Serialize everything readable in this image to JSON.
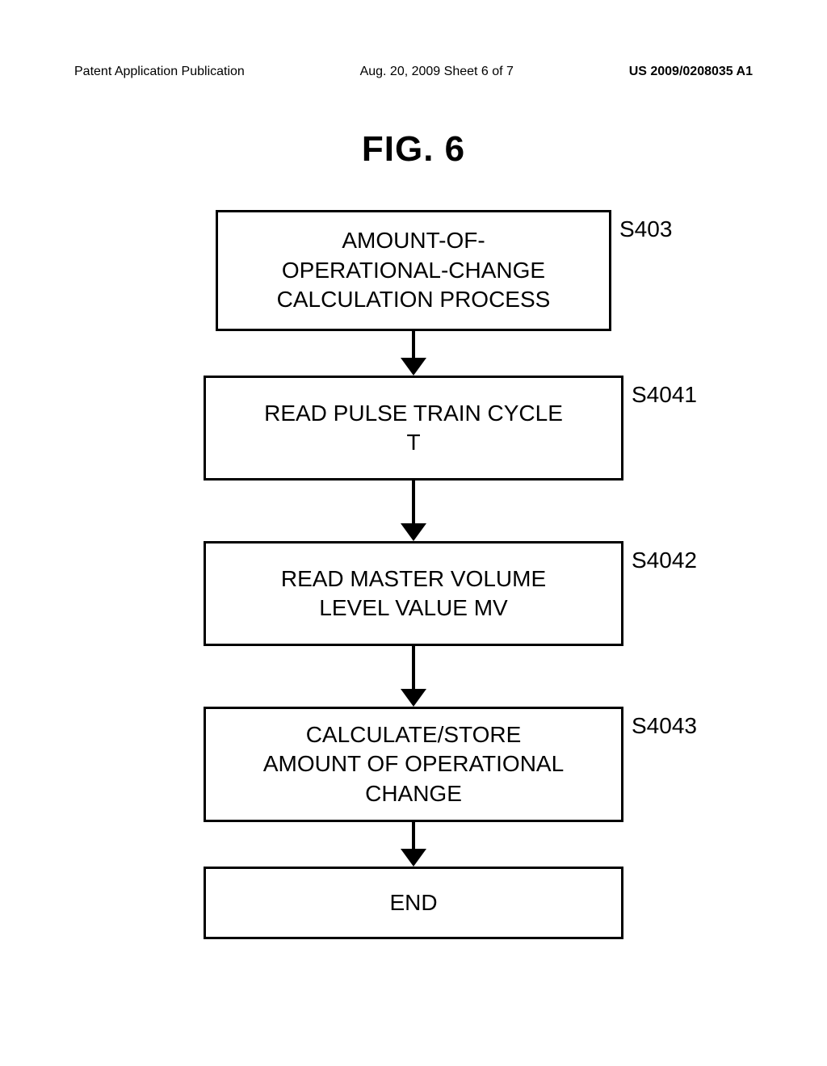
{
  "header": {
    "left": "Patent Application Publication",
    "center": "Aug. 20, 2009  Sheet 6 of 7",
    "right": "US 2009/0208035 A1"
  },
  "figure": {
    "title": "FIG. 6",
    "steps": {
      "s403": {
        "label": "S403",
        "line1": "AMOUNT-OF-",
        "line2": "OPERATIONAL-CHANGE",
        "line3": "CALCULATION PROCESS"
      },
      "s4041": {
        "label": "S4041",
        "line1": "READ PULSE TRAIN CYCLE",
        "line2": "T"
      },
      "s4042": {
        "label": "S4042",
        "line1": "READ MASTER VOLUME",
        "line2": "LEVEL VALUE MV"
      },
      "s4043": {
        "label": "S4043",
        "line1": "CALCULATE/STORE",
        "line2": "AMOUNT OF OPERATIONAL",
        "line3": "CHANGE"
      },
      "end": {
        "line1": "END"
      }
    }
  }
}
